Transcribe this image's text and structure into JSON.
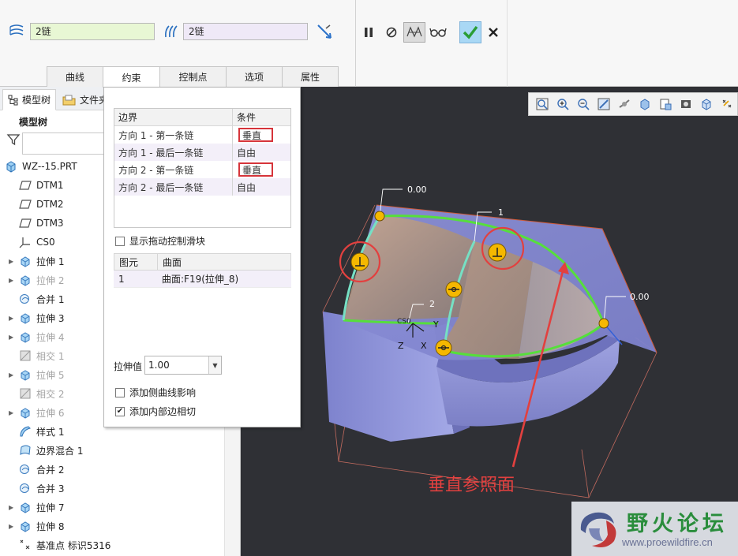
{
  "dashboard": {
    "chain_field_1": "2链",
    "chain_field_2": "2链",
    "tabs": [
      "曲线",
      "约束",
      "控制点",
      "选项",
      "属性"
    ],
    "active_tab": "约束"
  },
  "model_tree": {
    "tab_tree": "模型树",
    "tab_files": "文件夹",
    "heading": "模型树",
    "items": [
      {
        "label": "WZ--15.PRT",
        "icon": "part-icon",
        "expandable": false,
        "dim": false
      },
      {
        "label": "DTM1",
        "icon": "datum-plane-icon",
        "expandable": false,
        "dim": false
      },
      {
        "label": "DTM2",
        "icon": "datum-plane-icon",
        "expandable": false,
        "dim": false
      },
      {
        "label": "DTM3",
        "icon": "datum-plane-icon",
        "expandable": false,
        "dim": false
      },
      {
        "label": "CS0",
        "icon": "coord-system-icon",
        "expandable": false,
        "dim": false
      },
      {
        "label": "拉伸 1",
        "icon": "extrude-icon",
        "expandable": true,
        "dim": false
      },
      {
        "label": "拉伸 2",
        "icon": "extrude-icon",
        "expandable": true,
        "dim": true
      },
      {
        "label": "合并 1",
        "icon": "merge-icon",
        "expandable": false,
        "dim": false
      },
      {
        "label": "拉伸 3",
        "icon": "extrude-icon",
        "expandable": true,
        "dim": false
      },
      {
        "label": "拉伸 4",
        "icon": "extrude-icon",
        "expandable": true,
        "dim": true
      },
      {
        "label": "相交 1",
        "icon": "intersect-icon",
        "expandable": false,
        "dim": true
      },
      {
        "label": "拉伸 5",
        "icon": "extrude-icon",
        "expandable": true,
        "dim": true
      },
      {
        "label": "相交 2",
        "icon": "intersect-icon",
        "expandable": false,
        "dim": true
      },
      {
        "label": "拉伸 6",
        "icon": "extrude-icon",
        "expandable": true,
        "dim": true
      },
      {
        "label": "样式 1",
        "icon": "style-icon",
        "expandable": false,
        "dim": false
      },
      {
        "label": "边界混合 1",
        "icon": "boundary-blend-icon",
        "expandable": false,
        "dim": false
      },
      {
        "label": "合并 2",
        "icon": "merge-icon",
        "expandable": false,
        "dim": false
      },
      {
        "label": "合并 3",
        "icon": "merge-icon",
        "expandable": false,
        "dim": false
      },
      {
        "label": "拉伸 7",
        "icon": "extrude-icon",
        "expandable": true,
        "dim": false
      },
      {
        "label": "拉伸 8",
        "icon": "extrude-icon",
        "expandable": true,
        "dim": false
      },
      {
        "label": "基准点 标识5316",
        "icon": "datum-point-icon",
        "expandable": false,
        "dim": false
      }
    ]
  },
  "constraints_panel": {
    "boundary_header": "边界",
    "condition_header": "条件",
    "rows": [
      {
        "boundary": "方向 1 - 第一条链",
        "condition": "垂直",
        "highlighted": true
      },
      {
        "boundary": "方向 1 - 最后一条链",
        "condition": "自由",
        "highlighted": false
      },
      {
        "boundary": "方向 2 - 第一条链",
        "condition": "垂直",
        "highlighted": true
      },
      {
        "boundary": "方向 2 - 最后一条链",
        "condition": "自由",
        "highlighted": false
      }
    ],
    "show_drag_handles": "显示拖动控制滑块",
    "element_header": "图元",
    "surface_header": "曲面",
    "element_rows": [
      {
        "element": "1",
        "surface": "曲面:F19(拉伸_8)"
      }
    ],
    "stretch_label": "拉伸值",
    "stretch_value": "1.00",
    "add_side_curve": "添加侧曲线影响",
    "add_inner_edge": "添加内部边相切",
    "add_inner_edge_checked": true
  },
  "viewport": {
    "dim_label_top": "0.00",
    "dim_label_right": "0.00",
    "chain_label_1": "1",
    "chain_label_2": "2",
    "csys_label": "CS0",
    "axis_x": "X",
    "axis_y": "Y",
    "axis_z": "Z",
    "annotation": "垂直参照面",
    "annotation_color": "#e2403f"
  },
  "watermark": {
    "title": "野火论坛",
    "url": "www.proewildfire.cn"
  },
  "colors": {
    "accent_red": "#d6343a",
    "chain_green": "#5fe040",
    "handle_yellow": "#f5b800",
    "surface_blue": "#8a8fd8"
  }
}
